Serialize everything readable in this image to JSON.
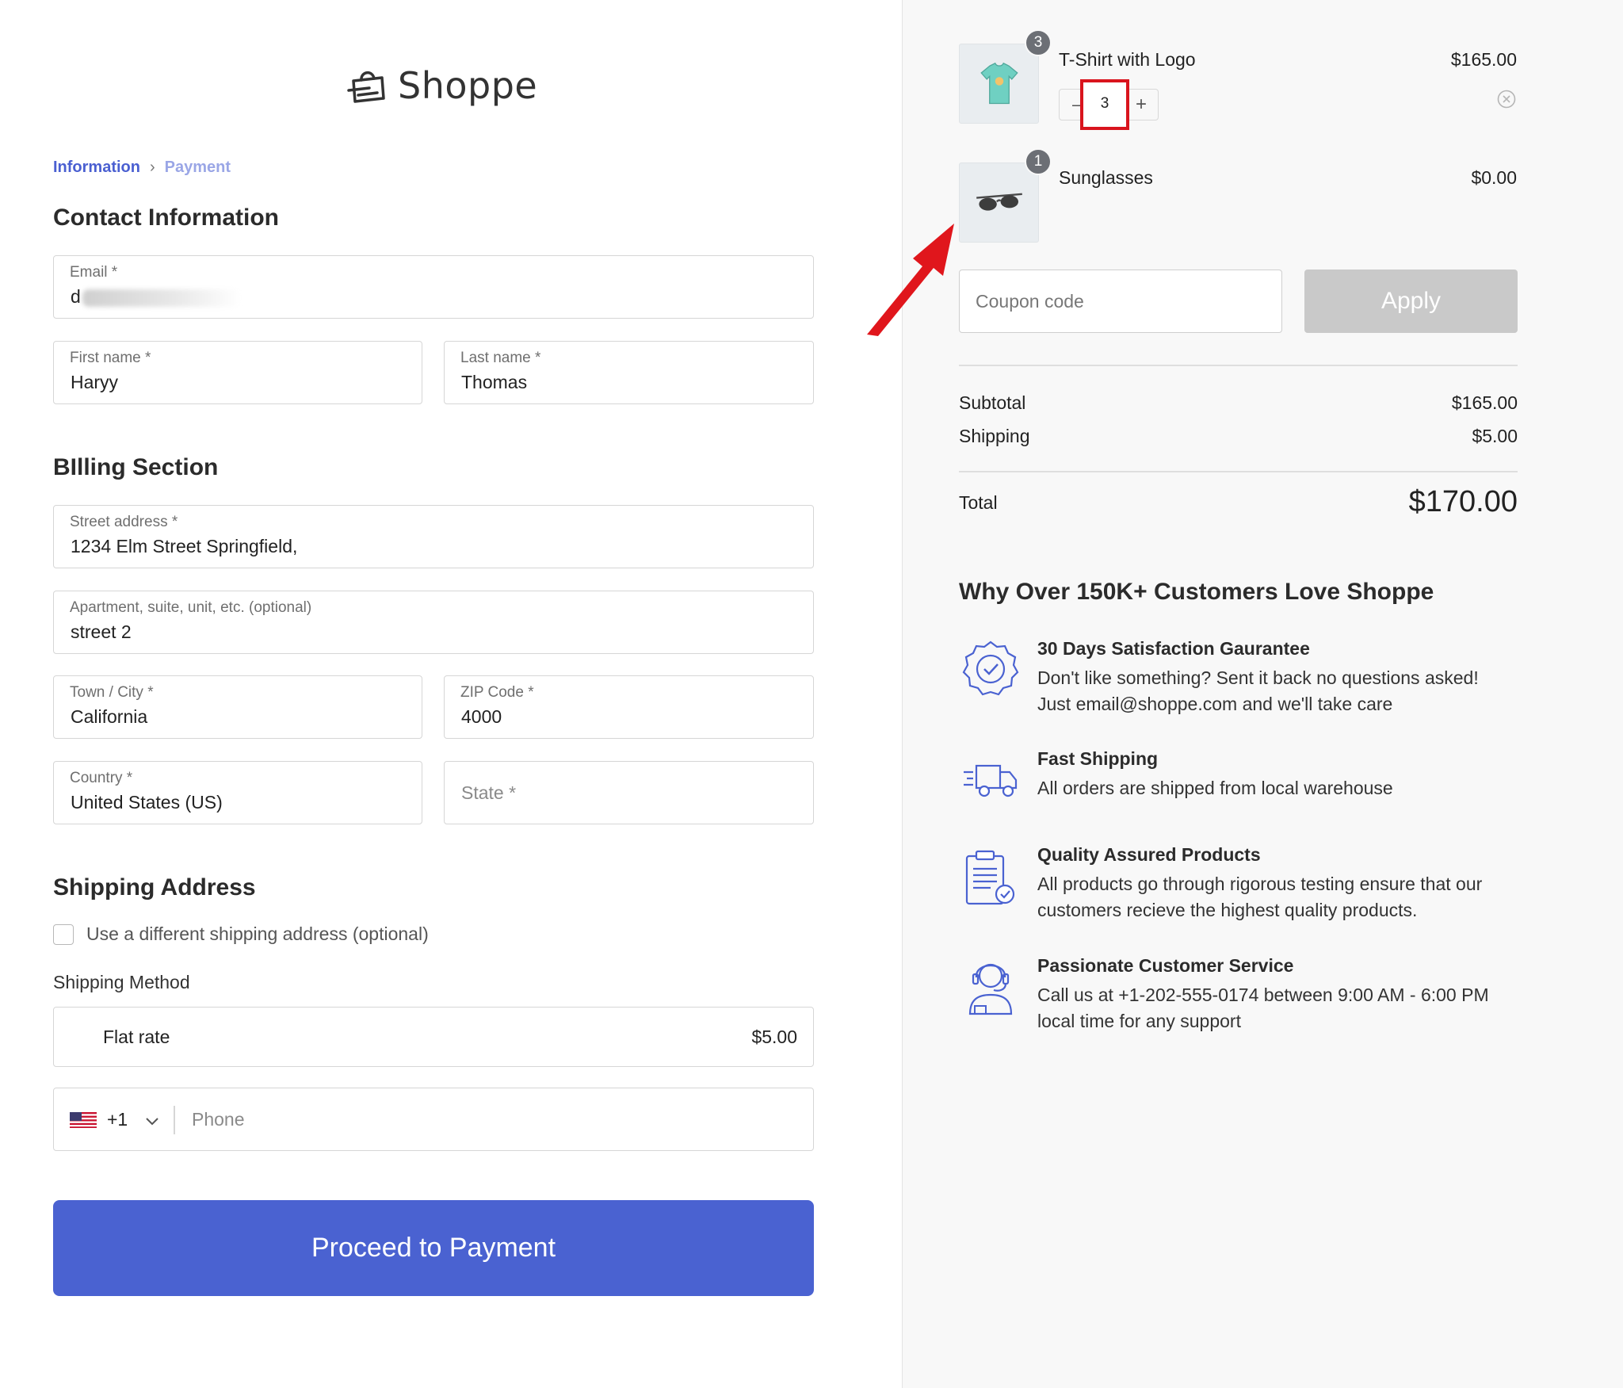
{
  "brand": {
    "name": "Shoppe"
  },
  "breadcrumb": {
    "current": "Information",
    "next": "Payment"
  },
  "contact": {
    "title": "Contact Information",
    "email": {
      "label": "Email *",
      "value": "d"
    },
    "first_name": {
      "label": "First name *",
      "value": "Haryy"
    },
    "last_name": {
      "label": "Last name *",
      "value": "Thomas"
    }
  },
  "billing": {
    "title": "BIlling Section",
    "street": {
      "label": "Street address *",
      "value": "1234 Elm Street Springfield,"
    },
    "apartment": {
      "label": "Apartment, suite, unit, etc. (optional)",
      "value": "street 2"
    },
    "city": {
      "label": "Town / City *",
      "value": "California"
    },
    "zip": {
      "label": "ZIP Code *",
      "value": "4000"
    },
    "country": {
      "label": "Country *",
      "value": "United States (US)"
    },
    "state": {
      "placeholder": "State *"
    }
  },
  "shipping": {
    "title": "Shipping Address",
    "different_address_label": "Use a different shipping address (optional)",
    "different_address_checked": false,
    "method_label": "Shipping Method",
    "method": {
      "name": "Flat rate",
      "price": "$5.00"
    }
  },
  "phone": {
    "dial_code": "+1",
    "placeholder": "Phone",
    "flag": "us-flag-icon"
  },
  "proceed_label": "Proceed to Payment",
  "cart": {
    "items": [
      {
        "name": "T-Shirt with Logo",
        "price": "$165.00",
        "quantity": "3",
        "badge": "3",
        "image": "tshirt-thumbnail"
      },
      {
        "name": "Sunglasses",
        "price": "$0.00",
        "badge": "1",
        "image": "sunglasses-thumbnail"
      }
    ],
    "coupon_placeholder": "Coupon code",
    "apply_label": "Apply",
    "subtotal_label": "Subtotal",
    "subtotal": "$165.00",
    "shipping_label": "Shipping",
    "shipping": "$5.00",
    "total_label": "Total",
    "total": "$170.00"
  },
  "why": {
    "title": "Why Over 150K+ Customers Love Shoppe",
    "features": [
      {
        "title": "30 Days Satisfaction Gaurantee",
        "line1": "Don't like something? Sent it back no questions asked!",
        "line2": "Just email@shoppe.com and we'll take care",
        "icon": "award-badge-icon"
      },
      {
        "title": "Fast Shipping",
        "line1": "All orders are shipped from local warehouse",
        "line2": "",
        "icon": "delivery-truck-icon"
      },
      {
        "title": "Quality Assured Products",
        "line1": "All products go through rigorous testing ensure that our",
        "line2": "customers recieve the highest quality products.",
        "icon": "clipboard-check-icon"
      },
      {
        "title": "Passionate Customer Service",
        "line1": "Call us at +1-202-555-0174 between 9:00 AM - 6:00 PM",
        "line2": "local time for any support",
        "icon": "support-agent-icon"
      }
    ]
  },
  "colors": {
    "accent": "#4a62d1",
    "highlight": "#d9141d",
    "apply_disabled": "#c9c9c9"
  }
}
